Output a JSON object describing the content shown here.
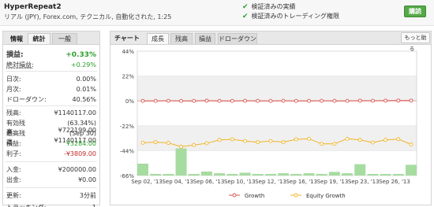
{
  "header": {
    "account_name": "HyperRepeat2",
    "account_desc": "リアル (JPY), Forex.com, テクニカル, 自動化された, 1:25",
    "verified_track_record": "検証済みの実績",
    "verified_trading_privileges": "検証済みのトレーディング権限",
    "subscribe_label": "購読"
  },
  "left_panel": {
    "tabs": [
      "情報",
      "統計",
      "一般"
    ],
    "stats": [
      {
        "label": "損益:",
        "value": "+0.33%",
        "style": "gain"
      },
      {
        "label": "絶対損益:",
        "value": "+0.29%",
        "style": "abs"
      },
      {
        "label": "日次:",
        "value": "0.00%"
      },
      {
        "label": "月次:",
        "value": "0.01%"
      },
      {
        "label": "ドローダウン:",
        "value": "40.56%"
      },
      {
        "label": "残高:",
        "value": "¥1140117.00"
      },
      {
        "label": "有効残高:",
        "value": "(63.34%) ¥722199.00"
      },
      {
        "label": "最高残高:",
        "value": "(Sep 30) ¥1140117.00"
      },
      {
        "label": "損益:",
        "value": "¥3284.00",
        "style": "green"
      },
      {
        "label": "利子:",
        "value": "-¥3809.00",
        "style": "red"
      },
      {
        "label": "入金:",
        "value": "¥200000.00"
      },
      {
        "label": "出金:",
        "value": "¥0.00"
      },
      {
        "label": "更新:",
        "value": "3分前"
      },
      {
        "label": "トラッキング:",
        "value": "1"
      }
    ]
  },
  "chart_panel": {
    "title": "チャート",
    "tabs": [
      "成長",
      "残高",
      "損益",
      "ドローダウン"
    ],
    "more_label": "もっと助",
    "right_marker": "る"
  },
  "chart_data": {
    "type": "line",
    "x_ticks": [
      "Sep 02, '13",
      "Sep 04, '13",
      "Sep 06, '13",
      "Sep 10, '13",
      "Sep 12, '13",
      "Sep 16, '13",
      "Sep 19, '13",
      "Sep 23, '13",
      "Sep 26, '13"
    ],
    "y_ticks": [
      "44%",
      "22%",
      "0%",
      "-22%",
      "-44%",
      "-66%"
    ],
    "ylim": [
      -66,
      44
    ],
    "series": [
      {
        "name": "Growth",
        "color": "#d9534f",
        "values": [
          0.0,
          0.0,
          0.1,
          0.0,
          0.0,
          0.2,
          0.0,
          0.0,
          0.1,
          0.0,
          0.0,
          0.1,
          0.0,
          0.0,
          0.1,
          0.0,
          0.0,
          0.2,
          0.1,
          0.2,
          0.3,
          0.3
        ]
      },
      {
        "name": "Equity Growth",
        "color": "#f0b428",
        "values": [
          -37.0,
          -36.5,
          -37.2,
          -40.5,
          -39.0,
          -37.5,
          -34.5,
          -34.0,
          -35.5,
          -36.5,
          -35.5,
          -36.5,
          -34.0,
          -33.5,
          -38.0,
          -38.0,
          -33.5,
          -34.5,
          -36.8,
          -34.5,
          -33.8,
          -38.5
        ]
      }
    ],
    "bars": [
      -55.5,
      -64.6,
      -64.6,
      -42.0,
      -64.6,
      -62.5,
      -64.0,
      -64.6,
      -63.5,
      -64.6,
      -64.6,
      -64.0,
      -64.6,
      -64.0,
      -64.6,
      -62.8,
      -64.0,
      -56.0,
      -64.6,
      -64.6,
      -64.6,
      -56.5
    ],
    "bar_color": "#a6dca0",
    "legend": [
      "Growth",
      "Equity Growth"
    ],
    "grid": true
  }
}
